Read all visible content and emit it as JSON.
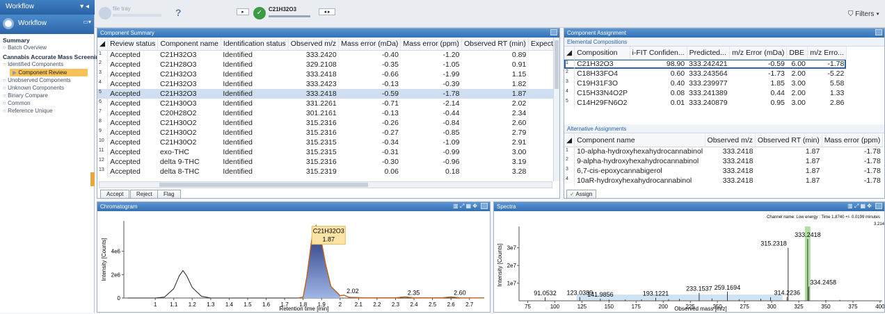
{
  "toolbar": {
    "workflow_tab": "Workflow",
    "file_tray": "file tray",
    "current_component": "C21H32O3",
    "filters_label": "Filters"
  },
  "sidebar": {
    "header": "Workflow",
    "items": [
      {
        "label": "Summary",
        "bold": true
      },
      {
        "label": "Batch Overview"
      },
      {
        "label": "Cannabis Accurate Mass Screenin...",
        "bold": true
      },
      {
        "label": "Identified Components"
      },
      {
        "label": "Component Review",
        "selected": true
      },
      {
        "label": "Unobserved Components"
      },
      {
        "label": "Unknown Components"
      },
      {
        "label": "Binary Compare"
      },
      {
        "label": "Common"
      },
      {
        "label": "Reference Unique"
      }
    ]
  },
  "component_summary": {
    "title": "Component Summary",
    "columns": [
      "Review status",
      "Component name",
      "Identification status",
      "Observed m/z",
      "Mass error (mDa)",
      "Mass error (ppm)",
      "Observed RT (min)",
      "Expected RT (min)"
    ],
    "rows": [
      {
        "i": "1",
        "status": "Accepted",
        "name": "C21H32O3",
        "ident": "Identified",
        "mz": "333.2420",
        "mda": "-0.40",
        "ppm": "-1.20",
        "rt": "0.89",
        "ert": ""
      },
      {
        "i": "2",
        "status": "Accepted",
        "name": "C21H28O3",
        "ident": "Identified",
        "mz": "329.2108",
        "mda": "-0.35",
        "ppm": "-1.05",
        "rt": "0.91",
        "ert": ""
      },
      {
        "i": "3",
        "status": "Accepted",
        "name": "C21H32O3",
        "ident": "Identified",
        "mz": "333.2418",
        "mda": "-0.66",
        "ppm": "-1.99",
        "rt": "1.15",
        "ert": ""
      },
      {
        "i": "4",
        "status": "Accepted",
        "name": "C21H32O3",
        "ident": "Identified",
        "mz": "333.2423",
        "mda": "-0.13",
        "ppm": "-0.39",
        "rt": "1.82",
        "ert": ""
      },
      {
        "i": "5",
        "status": "Accepted",
        "name": "C21H32O3",
        "ident": "Identified",
        "mz": "333.2418",
        "mda": "-0.59",
        "ppm": "-1.78",
        "rt": "1.87",
        "ert": ""
      },
      {
        "i": "6",
        "status": "Accepted",
        "name": "C21H30O3",
        "ident": "Identified",
        "mz": "331.2261",
        "mda": "-0.71",
        "ppm": "-2.14",
        "rt": "2.02",
        "ert": ""
      },
      {
        "i": "7",
        "status": "Accepted",
        "name": "C20H28O2",
        "ident": "Identified",
        "mz": "301.2161",
        "mda": "-0.13",
        "ppm": "-0.44",
        "rt": "2.34",
        "ert": ""
      },
      {
        "i": "8",
        "status": "Accepted",
        "name": "C21H30O2",
        "ident": "Identified",
        "mz": "315.2316",
        "mda": "-0.26",
        "ppm": "-0.84",
        "rt": "2.60",
        "ert": ""
      },
      {
        "i": "9",
        "status": "Accepted",
        "name": "C21H30O2",
        "ident": "Identified",
        "mz": "315.2316",
        "mda": "-0.27",
        "ppm": "-0.85",
        "rt": "2.79",
        "ert": ""
      },
      {
        "i": "10",
        "status": "Accepted",
        "name": "C21H30O2",
        "ident": "Identified",
        "mz": "315.2315",
        "mda": "-0.34",
        "ppm": "-1.09",
        "rt": "2.91",
        "ert": ""
      },
      {
        "i": "11",
        "status": "Accepted",
        "name": "exo-THC",
        "ident": "Identified",
        "mz": "315.2315",
        "mda": "-0.31",
        "ppm": "-0.99",
        "rt": "3.00",
        "ert": ""
      },
      {
        "i": "12",
        "status": "Accepted",
        "name": "delta 9-THC",
        "ident": "Identified",
        "mz": "315.2316",
        "mda": "-0.30",
        "ppm": "-0.96",
        "rt": "3.19",
        "ert": ""
      },
      {
        "i": "13",
        "status": "Accepted",
        "name": "delta 8-THC",
        "ident": "Identified",
        "mz": "315.2319",
        "mda": "0.06",
        "ppm": "0.18",
        "rt": "3.28",
        "ert": ""
      }
    ],
    "buttons": {
      "accept": "Accept",
      "reject": "Reject",
      "flag": "Flag"
    }
  },
  "component_assignment": {
    "title": "Component Assignment",
    "elemental_title": "Elemental Compositions",
    "elemental_columns": [
      "Composition",
      "i-FIT Confiden...",
      "Predicted...",
      "m/z Error (mDa)",
      "DBE",
      "m/z Erro..."
    ],
    "elemental_rows": [
      {
        "i": "1",
        "comp": "C21H32O3",
        "ifit": "98.90",
        "pred": "333.242421",
        "err": "-0.59",
        "dbe": "6.00",
        "ppm": "-1.78"
      },
      {
        "i": "2",
        "comp": "C18H33FO4",
        "ifit": "0.60",
        "pred": "333.243564",
        "err": "-1.73",
        "dbe": "2.00",
        "ppm": "-5.22"
      },
      {
        "i": "3",
        "comp": "C19H31F3O",
        "ifit": "0.40",
        "pred": "333.239977",
        "err": "1.85",
        "dbe": "3.00",
        "ppm": "5.58"
      },
      {
        "i": "4",
        "comp": "C15H33N4O2P",
        "ifit": "0.08",
        "pred": "333.241389",
        "err": "0.44",
        "dbe": "2.00",
        "ppm": "1.33"
      },
      {
        "i": "5",
        "comp": "C14H29FN6O2",
        "ifit": "0.01",
        "pred": "333.240879",
        "err": "0.95",
        "dbe": "3.00",
        "ppm": "2.86"
      }
    ],
    "alt_title": "Alternative Assignments",
    "alt_columns": [
      "Component name",
      "Observed m/z",
      "Observed RT (min)",
      "Mass error (ppm)"
    ],
    "alt_rows": [
      {
        "i": "1",
        "name": "10-alpha-hydroxyhexahydrocannabinol",
        "mz": "333.2418",
        "rt": "1.87",
        "ppm": "-1.78"
      },
      {
        "i": "2",
        "name": "9-alpha-hydroxyhexahydrocannabinol",
        "mz": "333.2418",
        "rt": "1.87",
        "ppm": "-1.78"
      },
      {
        "i": "3",
        "name": "6,7-cis-epoxycannabigerol",
        "mz": "333.2418",
        "rt": "1.87",
        "ppm": "-1.78"
      },
      {
        "i": "4",
        "name": "10aR-hydroxyhexahydrocannabinol",
        "mz": "333.2418",
        "rt": "1.87",
        "ppm": "-1.78"
      }
    ],
    "assign_label": "Assign"
  },
  "chart_data": [
    {
      "type": "line",
      "panel_title": "Chromatogram",
      "xlabel": "Retention time [min]",
      "ylabel": "Intensity [Counts]",
      "xlim": [
        0.83,
        2.78
      ],
      "ylim": [
        0,
        6600000.0
      ],
      "xticks": [
        "1",
        "1.1",
        "1.2",
        "1.3",
        "1.4",
        "1.5",
        "1.6",
        "1.7",
        "1.8",
        "1.9",
        "2",
        "2.1",
        "2.2",
        "2.3",
        "2.4",
        "2.5",
        "2.6",
        "2.7"
      ],
      "yticks": [
        {
          "v": 0,
          "label": "0"
        },
        {
          "v": 2000000,
          "label": "2e6"
        },
        {
          "v": 4000000,
          "label": "4e6"
        }
      ],
      "series": [
        {
          "color": "#222222",
          "x": [
            0.85,
            1.0,
            1.05,
            1.1,
            1.13,
            1.15,
            1.17,
            1.2,
            1.25,
            1.3,
            1.35,
            1.45,
            1.6,
            1.8,
            1.82,
            1.85,
            1.87,
            1.89,
            1.92,
            1.95,
            2.0,
            2.02,
            2.05,
            2.2,
            2.35,
            2.6,
            2.78
          ],
          "y": [
            0,
            0,
            80000,
            800000,
            1900000,
            2350000,
            1900000,
            900000,
            150000,
            0,
            0,
            0,
            0,
            0,
            1800000,
            5400000,
            6200000,
            5600000,
            3000000,
            1000000,
            200000,
            250000,
            60000,
            0,
            0,
            0,
            0
          ]
        },
        {
          "color": "#c0601a",
          "fill": "#2f4e9a",
          "x": [
            1.77,
            1.8,
            1.82,
            1.85,
            1.87,
            1.89,
            1.92,
            1.95,
            2.0,
            2.02,
            2.05,
            2.1,
            2.3,
            2.35,
            2.4,
            2.55,
            2.6,
            2.65,
            2.78
          ],
          "y": [
            0,
            80000,
            1800000,
            5400000,
            6200000,
            5600000,
            3000000,
            1000000,
            200000,
            250000,
            60000,
            20000,
            20000,
            100000,
            20000,
            20000,
            90000,
            20000,
            10000
          ]
        }
      ],
      "annotations": [
        {
          "x": 1.87,
          "y": 6200000,
          "text": "C21H32O3",
          "sub": "1.87",
          "boxed": true
        },
        {
          "x": 2.02,
          "y": 250000,
          "text": "2.02"
        },
        {
          "x": 2.35,
          "y": 100000,
          "text": "2.35"
        },
        {
          "x": 2.6,
          "y": 90000,
          "text": "2.60"
        }
      ]
    },
    {
      "type": "bar",
      "panel_title": "Spectra",
      "channel_info": "Channel name: Low energy : Time 1.8740 +/- 0.0199 minutes",
      "xlabel": "Observed mass [m/z]",
      "ylabel": "Intensity [Counts]",
      "xlim": [
        67,
        402
      ],
      "ylim": [
        0,
        40500000.0
      ],
      "xticks": [
        "75",
        "100",
        "125",
        "150",
        "175",
        "200",
        "225",
        "250",
        "275",
        "300",
        "325",
        "350",
        "375",
        "400"
      ],
      "yticks": [
        {
          "v": 10000000,
          "label": "1e7"
        },
        {
          "v": 20000000,
          "label": "2e7"
        },
        {
          "v": 30000000,
          "label": "3e7"
        }
      ],
      "highlight_mz": 333.2418,
      "peaks": [
        {
          "x": 91.0532,
          "y": 2000000,
          "label": "91.0532"
        },
        {
          "x": 123.0389,
          "y": 2100000,
          "label": "123.0389"
        },
        {
          "x": 141.9856,
          "y": 1200000,
          "label": "141.9856"
        },
        {
          "x": 193.1221,
          "y": 1700000,
          "label": "193.1221"
        },
        {
          "x": 233.1537,
          "y": 4500000,
          "label": "233.1537"
        },
        {
          "x": 259.1694,
          "y": 5200000,
          "label": "259.1694"
        },
        {
          "x": 314.2236,
          "y": 2200000,
          "label": "314.2236"
        },
        {
          "x": 315.2318,
          "y": 30000000,
          "label": "315.2318"
        },
        {
          "x": 333.2418,
          "y": 35000000,
          "label": "333.2418"
        },
        {
          "x": 334.2458,
          "y": 8000000,
          "label": "334.2458"
        },
        {
          "x": 150,
          "y": 600000
        },
        {
          "x": 165,
          "y": 700000
        },
        {
          "x": 180,
          "y": 800000
        },
        {
          "x": 205,
          "y": 900000
        },
        {
          "x": 215,
          "y": 1100000
        },
        {
          "x": 245,
          "y": 1300000
        },
        {
          "x": 270,
          "y": 900000
        },
        {
          "x": 290,
          "y": 1200000
        },
        {
          "x": 299,
          "y": 2000000
        },
        {
          "x": 350,
          "y": 400000
        },
        {
          "x": 363,
          "y": 500000
        }
      ],
      "clipped_label": "3.214"
    }
  ]
}
